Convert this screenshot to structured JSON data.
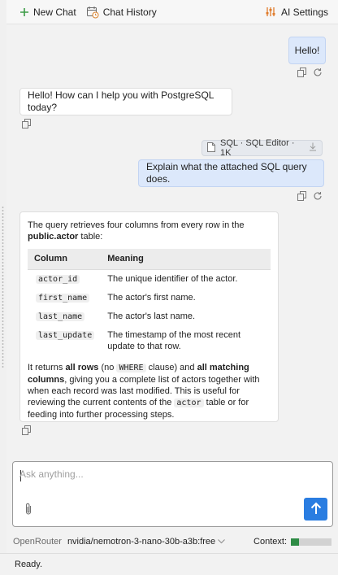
{
  "toolbar": {
    "new_chat": "New Chat",
    "chat_history": "Chat History",
    "ai_settings": "AI Settings"
  },
  "messages": {
    "user_hello": "Hello!",
    "bot_greeting": "Hello! How can I help you with PostgreSQL today?",
    "attachment": "SQL · SQL Editor · 1K",
    "user_question": "Explain what the attached SQL query does."
  },
  "answer": {
    "intro_1": "The query retrieves four columns from every row in the",
    "intro_table": "public.actor",
    "intro_2": "table:",
    "table": {
      "headers": [
        "Column",
        "Meaning"
      ],
      "rows": [
        [
          "actor_id",
          "The unique identifier of the actor."
        ],
        [
          "first_name",
          "The actor's first name."
        ],
        [
          "last_name",
          "The actor's last name."
        ],
        [
          "last_update",
          "The timestamp of the most recent update to that row."
        ]
      ]
    },
    "outro": {
      "t1": "It returns",
      "b1": "all rows",
      "t2": "(no",
      "c1": "WHERE",
      "t3": "clause) and",
      "b2": "all matching columns",
      "t4": ", giving you a complete list of actors together with when each record was last modified. This is useful for reviewing the current contents of the",
      "c2": "actor",
      "t5": "table or for feeding into further processing steps."
    }
  },
  "input": {
    "placeholder": "Ask anything..."
  },
  "model_bar": {
    "provider": "OpenRouter",
    "model": "nvidia/nemotron-3-nano-30b-a3b:free",
    "context_label": "Context:",
    "context_fraction": 0.2
  },
  "status": {
    "text": "Ready."
  },
  "colors": {
    "accent": "#2a7de1",
    "user_bubble": "#dce8fb",
    "context_fill": "#2e8b45",
    "new_chat_icon": "#3d9c47",
    "settings_icon": "#e07b2a"
  }
}
